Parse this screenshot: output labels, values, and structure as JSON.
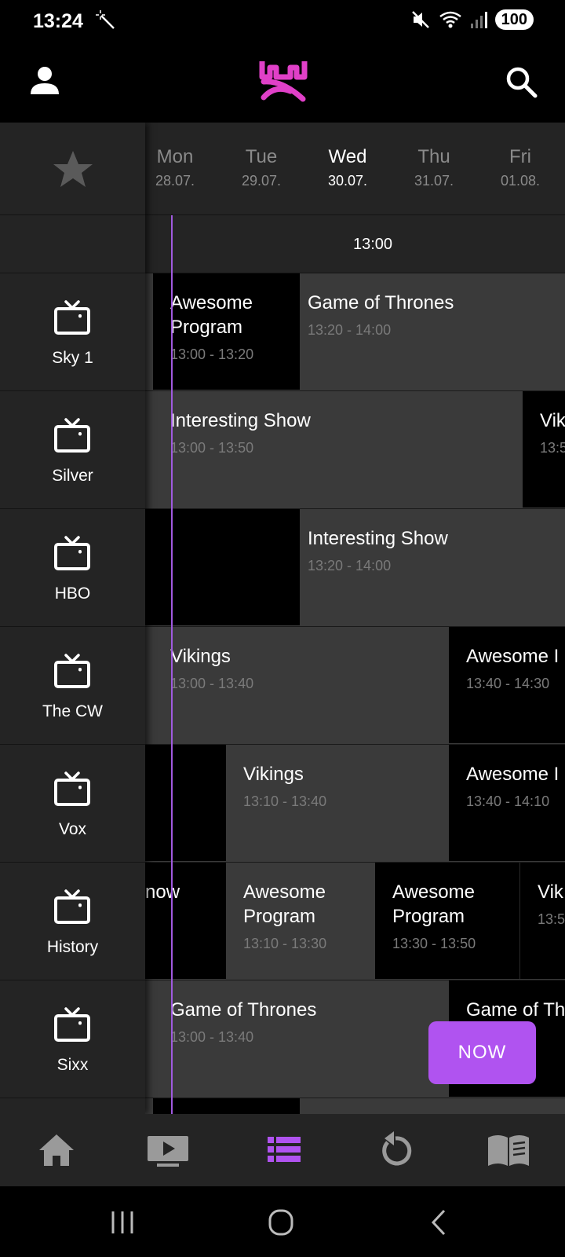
{
  "status_bar": {
    "time": "13:24",
    "battery": "100"
  },
  "colors": {
    "accent": "#b053f0",
    "logo_pink": "#e040c8",
    "now_line": "#a05adf"
  },
  "days": [
    {
      "name": "Mon",
      "date": "28.07.",
      "active": false
    },
    {
      "name": "Tue",
      "date": "29.07.",
      "active": false
    },
    {
      "name": "Wed",
      "date": "30.07.",
      "active": true
    },
    {
      "name": "Thu",
      "date": "31.07.",
      "active": false
    },
    {
      "name": "Fri",
      "date": "01.08.",
      "active": false
    }
  ],
  "time_label": "13:00",
  "channels": [
    {
      "name": "Sky 1",
      "programs": [
        {
          "title": "Awesome Program",
          "time": "13:00 - 13:20"
        },
        {
          "title": "Game of Thrones",
          "time": "13:20 - 14:00"
        }
      ]
    },
    {
      "name": "Silver",
      "programs": [
        {
          "title": "Interesting Show",
          "time": "13:00 - 13:50"
        },
        {
          "title": "Vik",
          "time": "13:5"
        }
      ]
    },
    {
      "name": "HBO",
      "programs": [
        {
          "title": "",
          "time": ""
        },
        {
          "title": "Interesting Show",
          "time": "13:20 - 14:00"
        }
      ]
    },
    {
      "name": "The CW",
      "programs": [
        {
          "title": "Vikings",
          "time": "13:00 - 13:40"
        },
        {
          "title": "Awesome I",
          "time": "13:40 - 14:30"
        }
      ]
    },
    {
      "name": "Vox",
      "programs": [
        {
          "title": "",
          "time": ""
        },
        {
          "title": "Vikings",
          "time": "13:10 - 13:40"
        },
        {
          "title": "Awesome I",
          "time": "13:40 - 14:10"
        }
      ]
    },
    {
      "name": "History",
      "programs": [
        {
          "title": "now",
          "time": ""
        },
        {
          "title": "Awesome Program",
          "time": "13:10 - 13:30"
        },
        {
          "title": "Awesome Program",
          "time": "13:30 - 13:50"
        },
        {
          "title": "Vik",
          "time": "13:5"
        }
      ]
    },
    {
      "name": "Sixx",
      "programs": [
        {
          "title": "Game of Thrones",
          "time": "13:00 - 13:40"
        },
        {
          "title": "Game of Th",
          "time": ":10"
        }
      ]
    }
  ],
  "now_button": "NOW",
  "bottom_nav": [
    {
      "icon": "home-icon",
      "active": false
    },
    {
      "icon": "tv-play-icon",
      "active": false
    },
    {
      "icon": "guide-list-icon",
      "active": true
    },
    {
      "icon": "replay-icon",
      "active": false
    },
    {
      "icon": "book-icon",
      "active": false
    }
  ]
}
